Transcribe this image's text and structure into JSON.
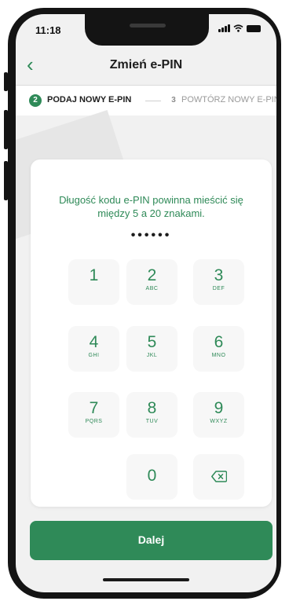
{
  "status_bar": {
    "time": "11:18"
  },
  "header": {
    "back_icon": "chevron-left-icon",
    "title": "Zmień e-PIN"
  },
  "steps": [
    {
      "number": "2",
      "label": "PODAJ NOWY E-PIN",
      "active": true
    },
    {
      "number": "3",
      "label": "POWTÓRZ NOWY E-PIN",
      "active": false
    }
  ],
  "pin": {
    "hint": "Długość kodu e-PIN powinna mieścić się między 5 a 20 znakami.",
    "masked": "••••••"
  },
  "keypad": {
    "keys": [
      {
        "digit": "1",
        "letters": ""
      },
      {
        "digit": "2",
        "letters": "ABC"
      },
      {
        "digit": "3",
        "letters": "DEF"
      },
      {
        "digit": "4",
        "letters": "GHI"
      },
      {
        "digit": "5",
        "letters": "JKL"
      },
      {
        "digit": "6",
        "letters": "MNO"
      },
      {
        "digit": "7",
        "letters": "PQRS"
      },
      {
        "digit": "8",
        "letters": "TUV"
      },
      {
        "digit": "9",
        "letters": "WXYZ"
      },
      {
        "digit": "0",
        "letters": ""
      }
    ],
    "backspace_icon": "backspace-icon"
  },
  "actions": {
    "submit_label": "Dalej"
  },
  "colors": {
    "accent": "#2f8a58",
    "background": "#f1f1f1",
    "card": "#ffffff"
  }
}
